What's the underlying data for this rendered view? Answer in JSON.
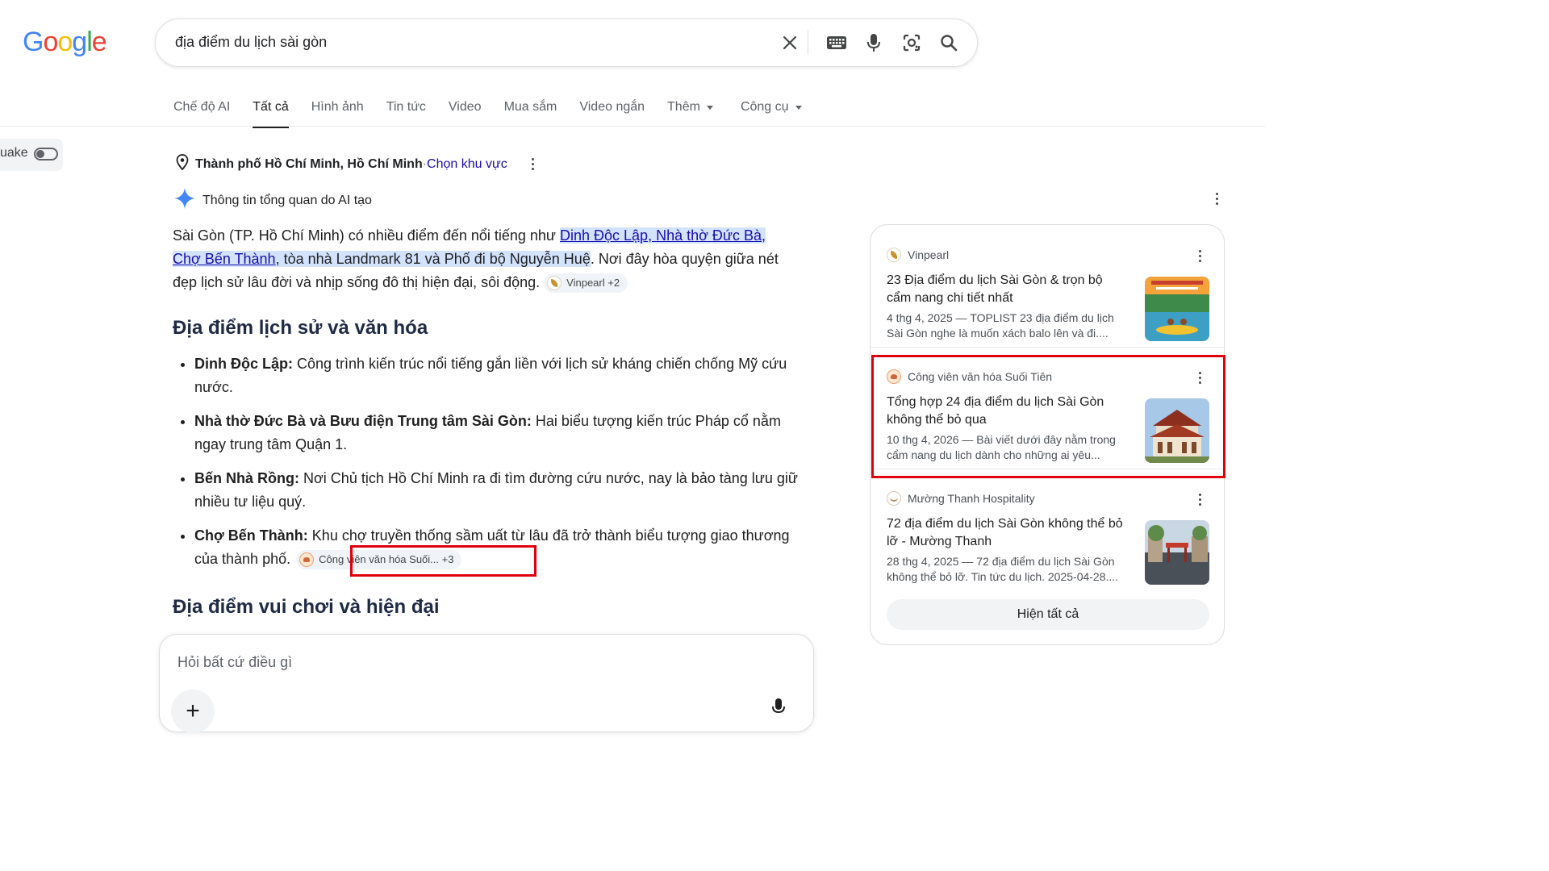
{
  "logo": {
    "letters": [
      "G",
      "o",
      "o",
      "g",
      "l",
      "e"
    ],
    "colors": [
      "#4285f4",
      "#ea4335",
      "#fbbc05",
      "#4285f4",
      "#34a853",
      "#ea4335"
    ]
  },
  "search": {
    "query": "địa điểm du lịch sài gòn"
  },
  "tabs": [
    {
      "label": "Chế độ AI"
    },
    {
      "label": "Tất cả",
      "active": true
    },
    {
      "label": "Hình ảnh"
    },
    {
      "label": "Tin tức"
    },
    {
      "label": "Video"
    },
    {
      "label": "Mua sắm"
    },
    {
      "label": "Video ngắn"
    },
    {
      "label": "Thêm",
      "dropdown": true
    },
    {
      "label": "Công cụ",
      "dropdown": true
    }
  ],
  "sidebar_toggle": {
    "label": "uake"
  },
  "location": {
    "place": "Thành phố Hồ Chí Minh, Hồ Chí Minh",
    "sep": " · ",
    "change_link": "Chọn khu vực"
  },
  "ai_overview": {
    "header": "Thông tin tổng quan do AI tạo",
    "intro": {
      "pre": "Sài Gòn (TP. Hồ Chí Minh) có nhiều điểm đến nổi tiếng như ",
      "link1": "Dinh Độc Lập",
      "comma1": ", ",
      "link2": "Nhà thờ Đức Bà",
      "comma2": ", ",
      "link3": "Chợ Bến Thành",
      "hl_rest": ", tòa nhà Landmark 81 và Phố đi bộ Nguyễn Huệ",
      "post": ". Nơi đây hòa quyện giữa nét đẹp lịch sử lâu đời và nhịp sống đô thị hiện đại, sôi động.",
      "chip": "Vinpearl +2"
    },
    "section1_title": "Địa điểm lịch sử và văn hóa",
    "bullets": [
      {
        "bold": "Dinh Độc Lập:",
        "text": " Công trình kiến trúc nổi tiếng gắn liền với lịch sử kháng chiến chống Mỹ cứu nước."
      },
      {
        "bold": "Nhà thờ Đức Bà và Bưu điện Trung tâm Sài Gòn:",
        "text": " Hai biểu tượng kiến trúc Pháp cổ nằm ngay trung tâm Quận 1."
      },
      {
        "bold": "Bến Nhà Rồng:",
        "text": " Nơi Chủ tịch Hồ Chí Minh ra đi tìm đường cứu nước, nay là bảo tàng lưu giữ nhiều tư liệu quý."
      },
      {
        "bold": "Chợ Bến Thành:",
        "text": " Khu chợ truyền thống sầm uất từ lâu đã trở thành biểu tượng giao thương của thành phố.",
        "chip": "Công viên văn hóa Suối... +3"
      }
    ],
    "section2_title": "Địa điểm vui chơi và hiện đại"
  },
  "ask_box": {
    "placeholder": "Hỏi bất cứ điều gì",
    "plus": "+"
  },
  "sources_panel": {
    "cards": [
      {
        "source": "Vinpearl",
        "title": "23 Địa điểm du lịch Sài Gòn & trọn bộ cẩm nang chi tiết nhất",
        "snippet": "4 thg 4, 2025 — TOPLIST 23 địa điểm du lịch Sài Gòn nghe là muốn xách balo lên và đi...."
      },
      {
        "source": "Công viên văn hóa Suối Tiên",
        "title": "Tổng hợp 24 địa điểm du lịch Sài Gòn không thể bỏ qua",
        "snippet": "10 thg 4, 2026 — Bài viết dưới đây nằm trong cẩm nang du lịch dành cho những ai yêu...",
        "highlighted": true
      },
      {
        "source": "Mường Thanh Hospitality",
        "title": "72 địa điểm du lịch Sài Gòn không thể bỏ lỡ - Mường Thanh",
        "snippet": "28 thg 4, 2025 — 72 địa điểm du lịch Sài Gòn không thể bỏ lỡ. Tin tức du lịch. 2025-04-28...."
      }
    ],
    "show_all": "Hiện tất cả"
  },
  "colors": {
    "link": "#1a0dab",
    "highlight": "#d3e3fd",
    "annotation_red": "#e0000c",
    "ai_spark": "#4285f4"
  }
}
